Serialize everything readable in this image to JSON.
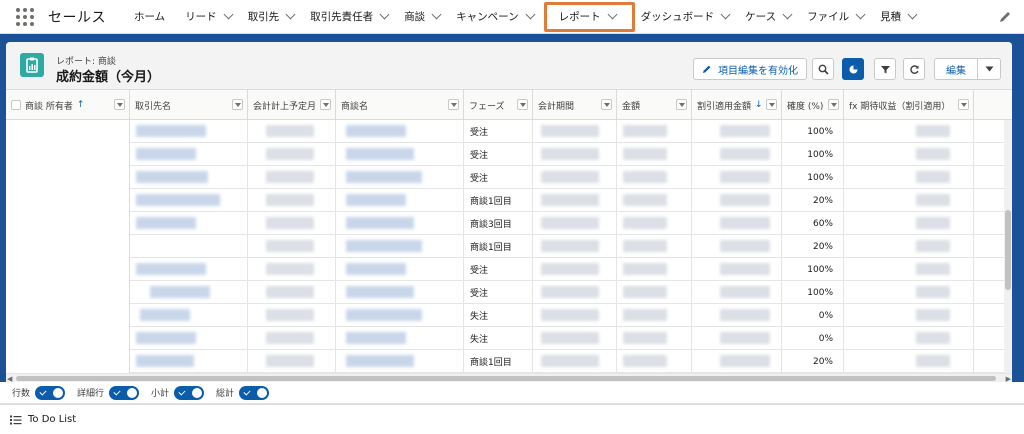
{
  "nav": {
    "app_name": "セールス",
    "items": [
      {
        "label": "ホーム",
        "chevron": false
      },
      {
        "label": "リード",
        "chevron": true
      },
      {
        "label": "取引先",
        "chevron": true
      },
      {
        "label": "取引先責任者",
        "chevron": true
      },
      {
        "label": "商談",
        "chevron": true
      },
      {
        "label": "キャンペーン",
        "chevron": true
      },
      {
        "label": "レポート",
        "chevron": true,
        "active": true
      },
      {
        "label": "ダッシュボード",
        "chevron": true
      },
      {
        "label": "ケース",
        "chevron": true
      },
      {
        "label": "ファイル",
        "chevron": true
      },
      {
        "label": "見積",
        "chevron": true
      }
    ]
  },
  "report": {
    "subtitle": "レポート: 商談",
    "title": "成約金額（今月）",
    "enable_field_edit_label": "項目編集を有効化",
    "edit_label": "編集"
  },
  "table": {
    "columns": [
      {
        "label": "商談 所有者",
        "sort": "↑"
      },
      {
        "label": "取引先名"
      },
      {
        "label": "会計計上予定月"
      },
      {
        "label": "商談名"
      },
      {
        "label": "フェーズ"
      },
      {
        "label": "会計期間"
      },
      {
        "label": "金額"
      },
      {
        "label": "割引適用金額",
        "sort": "↓"
      },
      {
        "label": "確度 (%)"
      },
      {
        "label": "fx 期待収益（割引適用）"
      }
    ],
    "rows": [
      {
        "phase": "受注",
        "prob": "100%"
      },
      {
        "phase": "受注",
        "prob": "100%"
      },
      {
        "phase": "受注",
        "prob": "100%"
      },
      {
        "phase": "商談1回目",
        "prob": "20%"
      },
      {
        "phase": "商談3回目",
        "prob": "60%"
      },
      {
        "phase": "商談1回目",
        "prob": "20%"
      },
      {
        "phase": "受注",
        "prob": "100%"
      },
      {
        "phase": "受注",
        "prob": "100%"
      },
      {
        "phase": "失注",
        "prob": "0%"
      },
      {
        "phase": "失注",
        "prob": "0%"
      },
      {
        "phase": "商談1回目",
        "prob": "20%"
      }
    ]
  },
  "footer": {
    "toggles": [
      {
        "label": "行数",
        "on": true
      },
      {
        "label": "詳細行",
        "on": true
      },
      {
        "label": "小計",
        "on": true
      },
      {
        "label": "総計",
        "on": true
      }
    ]
  },
  "utility": {
    "todo_label": "To Do List"
  },
  "colors": {
    "brand_blue": "#1b5297",
    "accent": "#0b5cab",
    "highlight": "#e07b3a",
    "report_icon": "#2fa9a4"
  }
}
